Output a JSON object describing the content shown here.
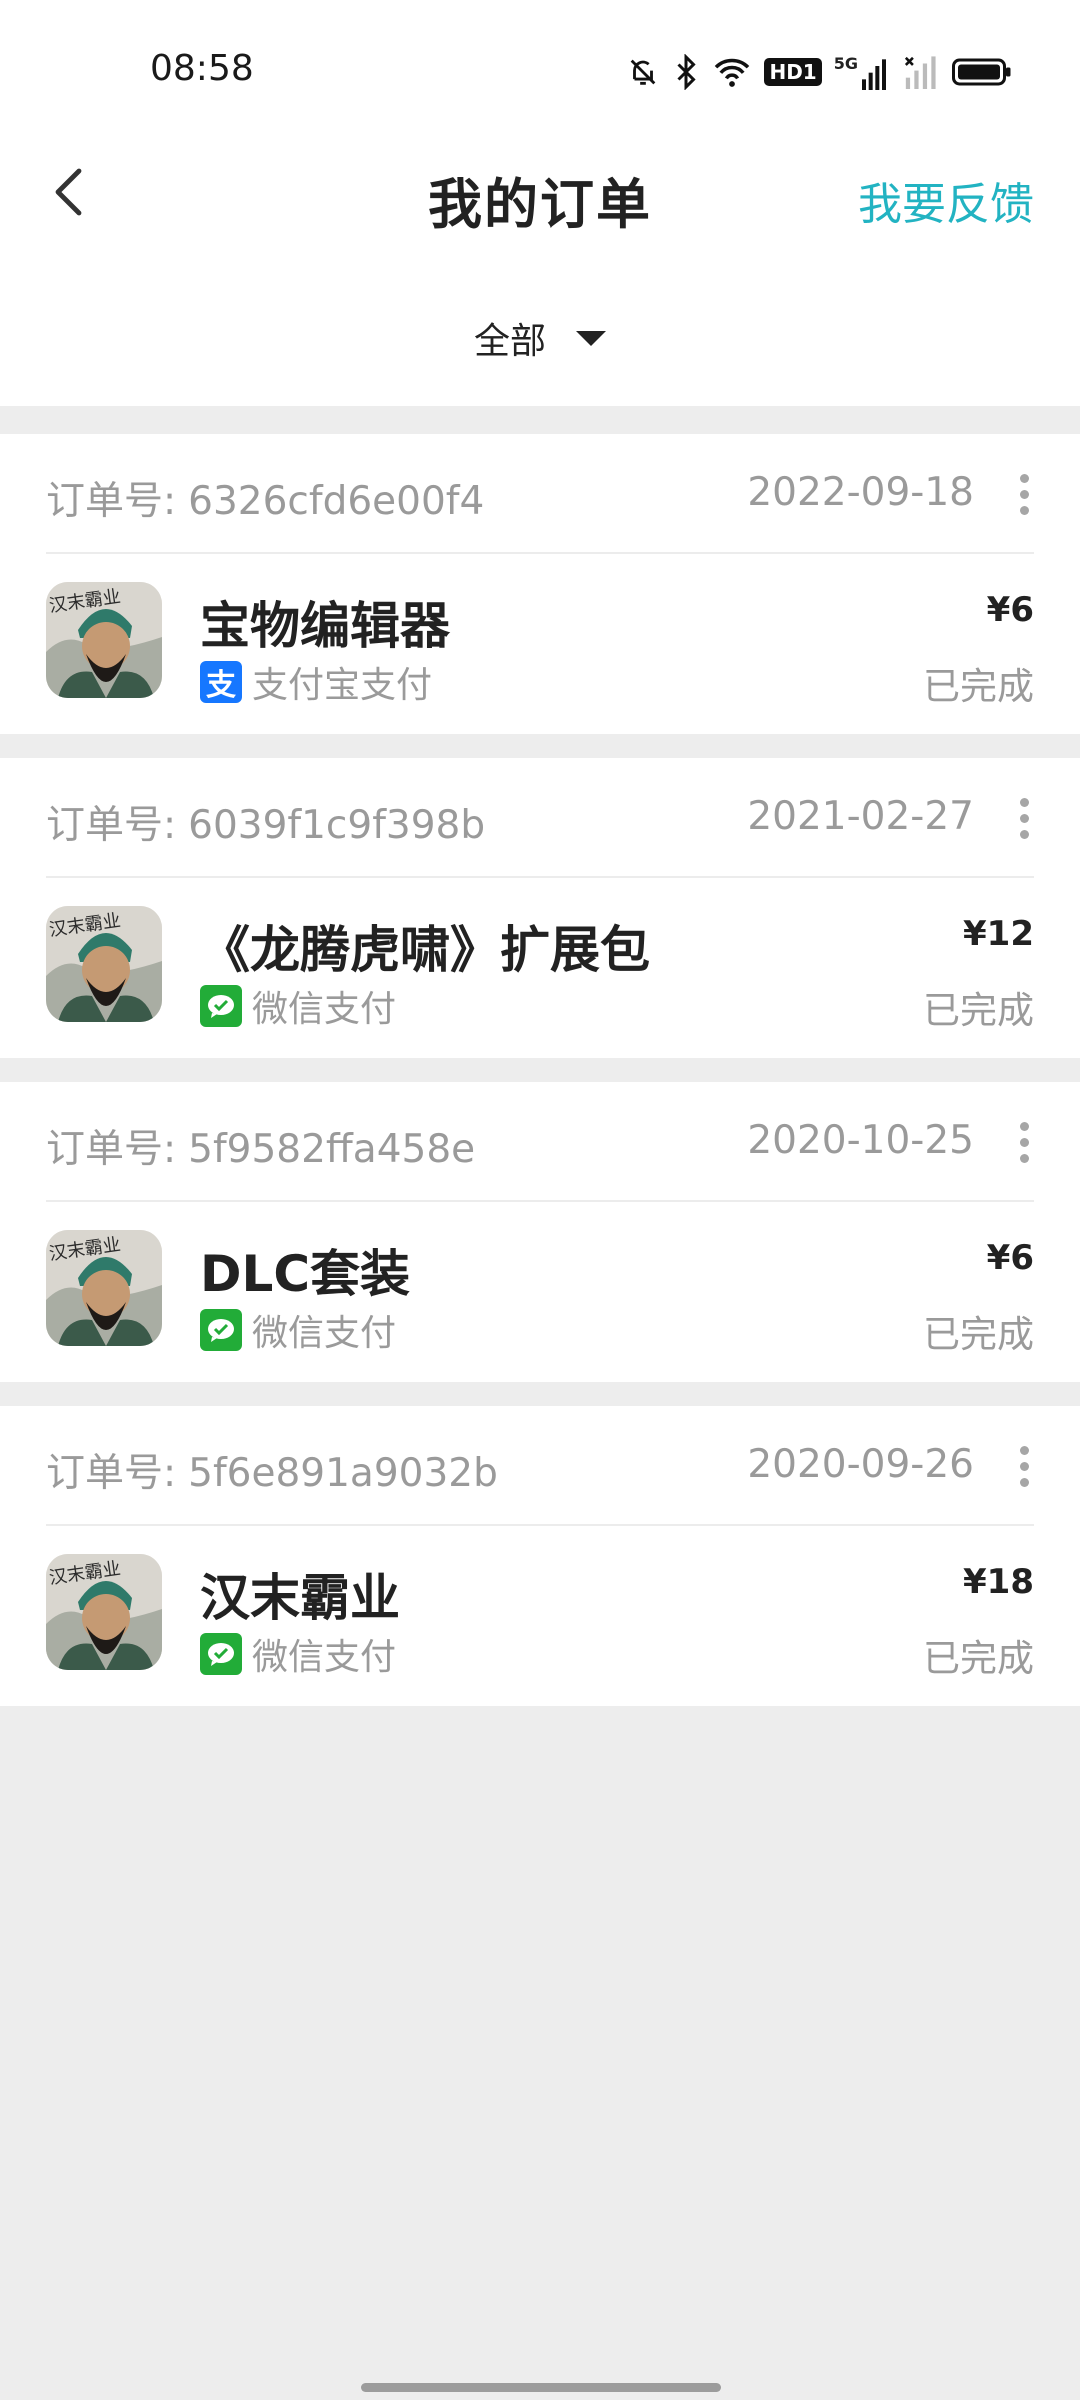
{
  "status": {
    "time": "08:58",
    "hd_badge": "HD1",
    "net_label": "5G"
  },
  "header": {
    "title": "我的订单",
    "feedback": "我要反馈"
  },
  "filter": {
    "label": "全部"
  },
  "orders": [
    {
      "order_label": "订单号:",
      "order_no": "6326cfd6e00f4",
      "date": "2022-09-18",
      "name": "宝物编辑器",
      "payment": "支付宝支付",
      "payment_icon": "alipay-icon",
      "price": "¥6",
      "status": "已完成"
    },
    {
      "order_label": "订单号:",
      "order_no": "6039f1c9f398b",
      "date": "2021-02-27",
      "name": "《龙腾虎啸》扩展包",
      "payment": "微信支付",
      "payment_icon": "wechat-pay-icon",
      "price": "¥12",
      "status": "已完成"
    },
    {
      "order_label": "订单号:",
      "order_no": "5f9582ffa458e",
      "date": "2020-10-25",
      "name": "DLC套装",
      "payment": "微信支付",
      "payment_icon": "wechat-pay-icon",
      "price": "¥6",
      "status": "已完成"
    },
    {
      "order_label": "订单号:",
      "order_no": "5f6e891a9032b",
      "date": "2020-09-26",
      "name": "汉末霸业",
      "payment": "微信支付",
      "payment_icon": "wechat-pay-icon",
      "price": "¥18",
      "status": "已完成"
    }
  ],
  "thumbnail": {
    "caption": "汉末霸业"
  },
  "colors": {
    "accent": "#22b3c2",
    "alipay": "#1677ff",
    "wechat": "#22ac38",
    "muted_text": "#9a9a9a",
    "background": "#ededed"
  }
}
